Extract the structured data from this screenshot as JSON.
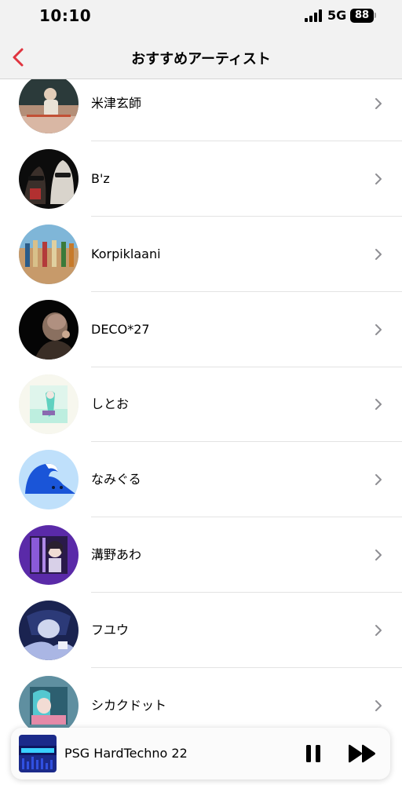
{
  "status_bar": {
    "time": "10:10",
    "network": "5G",
    "battery": "88"
  },
  "nav": {
    "title": "おすすめアーティスト",
    "back_icon": "chevron-left-icon",
    "accent_color": "#e0343f"
  },
  "artists": [
    {
      "name": "米津玄師"
    },
    {
      "name": "B'z"
    },
    {
      "name": "Korpiklaani"
    },
    {
      "name": "DECO*27"
    },
    {
      "name": "しとお"
    },
    {
      "name": "なみぐる"
    },
    {
      "name": "溝野あわ"
    },
    {
      "name": "フユウ"
    },
    {
      "name": "シカクドット"
    }
  ],
  "player": {
    "title": "PSG HardTechno 22",
    "pause_icon": "pause-icon",
    "forward_icon": "fast-forward-icon"
  }
}
